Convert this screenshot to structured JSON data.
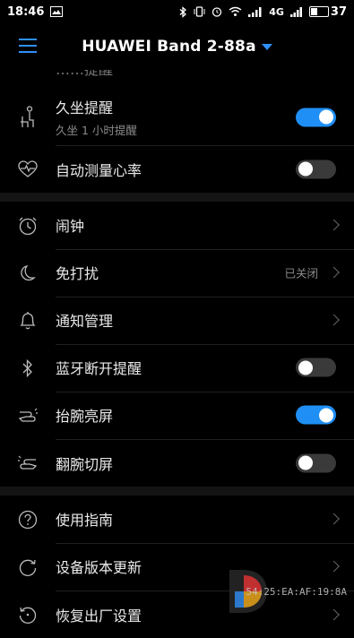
{
  "status": {
    "time": "18:46",
    "network_type": "4G",
    "battery": "37",
    "battery_level": 0.37
  },
  "header": {
    "title": "HUAWEI Band 2-88a"
  },
  "settings": {
    "partial_label": "……提醒",
    "sedentary": {
      "label": "久坐提醒",
      "sub": "久坐 1 小时提醒",
      "on": true
    },
    "heart_rate": {
      "label": "自动测量心率",
      "on": false
    },
    "alarm": {
      "label": "闹钟"
    },
    "dnd": {
      "label": "免打扰",
      "value": "已关闭"
    },
    "notifications": {
      "label": "通知管理"
    },
    "bt_disconnect": {
      "label": "蓝牙断开提醒",
      "on": false
    },
    "raise_wake": {
      "label": "抬腕亮屏",
      "on": true
    },
    "wrist_flip": {
      "label": "翻腕切屏",
      "on": false
    },
    "guide": {
      "label": "使用指南"
    },
    "firmware": {
      "label": "设备版本更新"
    },
    "factory_reset": {
      "label": "恢复出厂设置"
    }
  },
  "watermark": {
    "text": "54:25:EA:AF:19:8A"
  },
  "colors": {
    "accent": "#1f8ff5",
    "background": "#000000",
    "section_gap": "#141414"
  }
}
